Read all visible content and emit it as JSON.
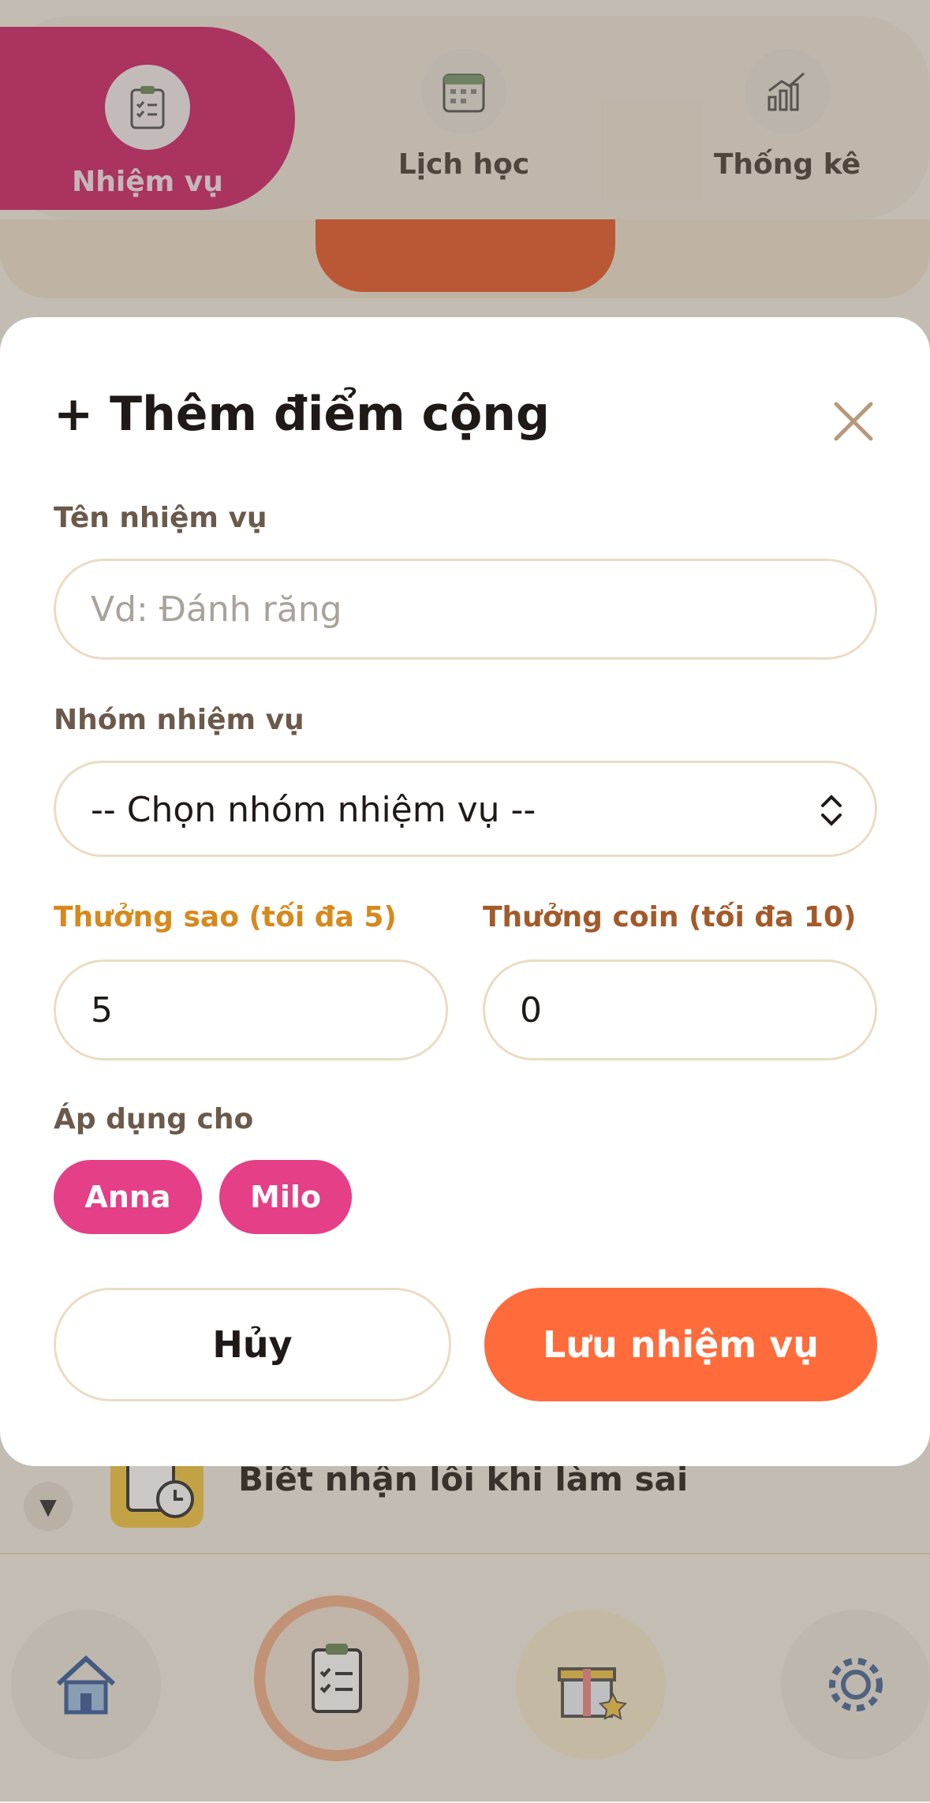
{
  "top_tabs": [
    {
      "label": "Nhiệm vụ",
      "icon": "clipboard-icon",
      "active": true
    },
    {
      "label": "Lịch học",
      "icon": "calendar-icon",
      "active": false
    },
    {
      "label": "Thống kê",
      "icon": "chart-icon",
      "active": false
    }
  ],
  "background_list": {
    "expand_glyph": "▼",
    "task_title": "Biết nhận lỗi khi làm sai"
  },
  "bottom_nav": [
    "home-icon",
    "tasks-icon",
    "gift-icon",
    "settings-icon"
  ],
  "modal": {
    "title": "+ Thêm điểm cộng",
    "task_name": {
      "label": "Tên nhiệm vụ",
      "placeholder": "Vd: Đánh răng",
      "value": ""
    },
    "task_group": {
      "label": "Nhóm nhiệm vụ",
      "selected": "-- Chọn nhóm nhiệm vụ --"
    },
    "stars": {
      "label": "Thưởng sao (tối đa 5)",
      "value": "5"
    },
    "coins": {
      "label": "Thưởng coin (tối đa 10)",
      "value": "0"
    },
    "apply_to": {
      "label": "Áp dụng cho",
      "children": [
        "Anna",
        "Milo"
      ]
    },
    "cancel_label": "Hủy",
    "save_label": "Lưu nhiệm vụ"
  },
  "colors": {
    "primary_pink": "#d0266c",
    "chip_pink": "#e43f87",
    "save_orange": "#ff6b3a",
    "star_label": "#d6891c",
    "coin_label": "#a35a2a"
  }
}
